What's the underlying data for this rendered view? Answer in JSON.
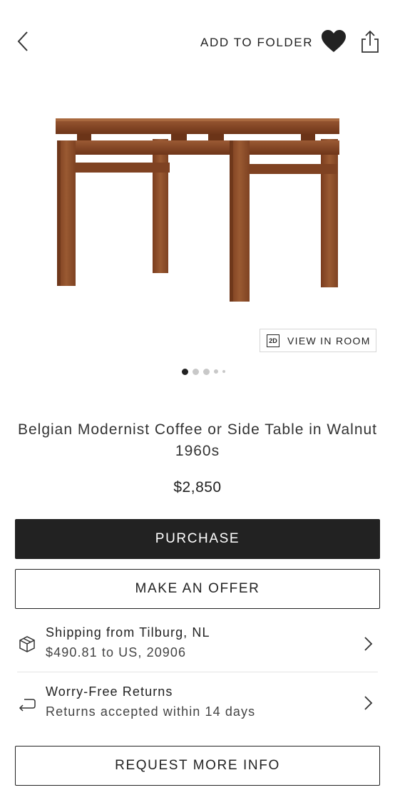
{
  "header": {
    "add_to_folder_label": "ADD TO FOLDER",
    "back_icon": "chevron-left-icon",
    "favorite_icon": "heart-icon",
    "share_icon": "share-icon"
  },
  "gallery": {
    "view_in_room_badge": "2D",
    "view_in_room_label": "VIEW IN ROOM",
    "image_count": 5,
    "active_index": 0
  },
  "product": {
    "title": "Belgian Modernist Coffee or Side Table in Walnut 1960s",
    "price": "$2,850"
  },
  "actions": {
    "purchase_label": "PURCHASE",
    "offer_label": "MAKE AN OFFER",
    "request_info_label": "REQUEST MORE INFO"
  },
  "shipping": {
    "title": "Shipping from Tilburg, NL",
    "detail": "$490.81 to US, 20906",
    "icon": "package-icon"
  },
  "returns": {
    "title": "Worry-Free Returns",
    "detail": "Returns accepted within 14 days",
    "icon": "return-arrow-icon"
  },
  "colors": {
    "primary_button": "#222222",
    "text": "#222222",
    "divider": "#e3e3e3",
    "wood": "#8a4a26"
  }
}
